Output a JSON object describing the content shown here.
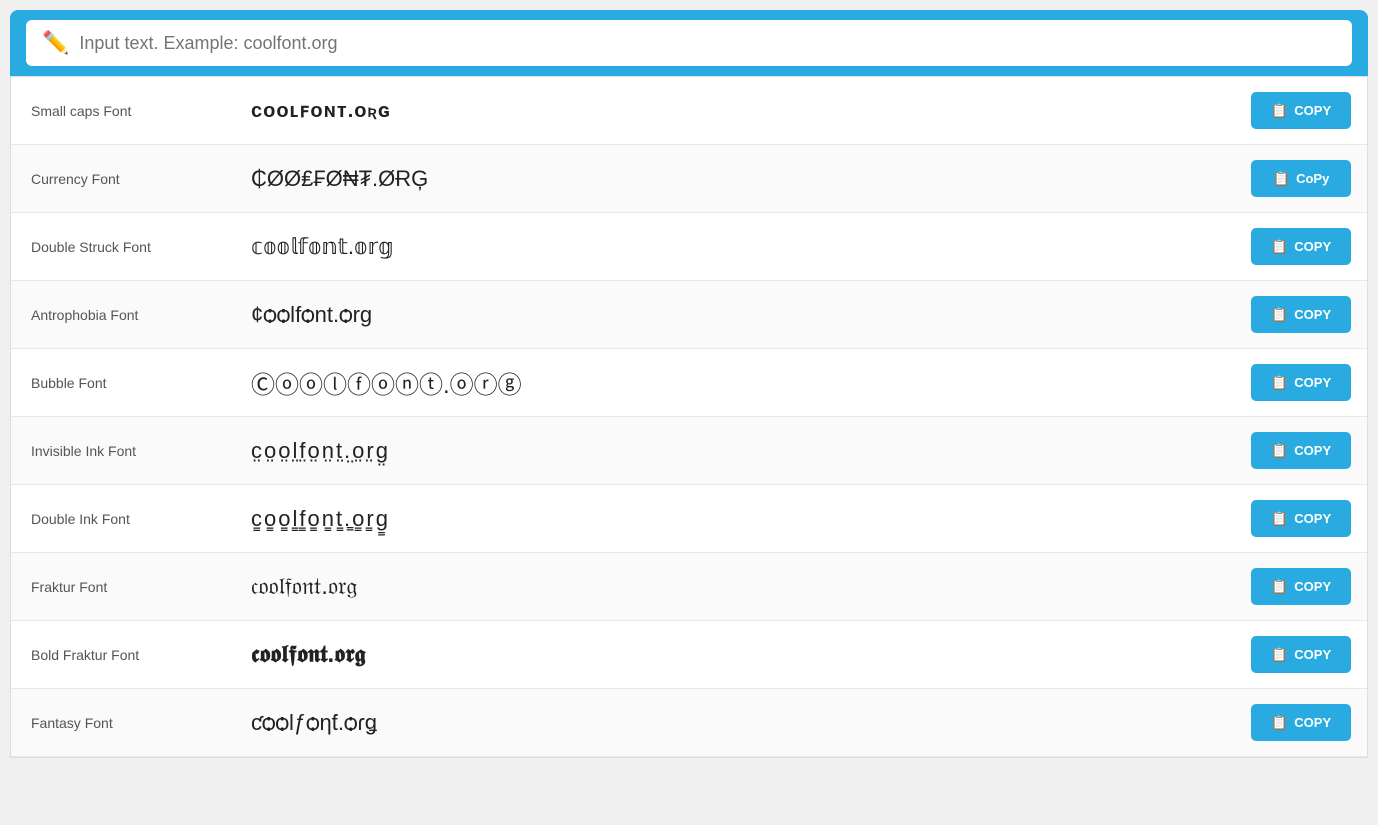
{
  "header": {
    "search_placeholder": "Input text. Example: coolfont.org",
    "pencil_icon": "✏️"
  },
  "rows": [
    {
      "label": "Small caps Font",
      "preview": "ᴄᴏᴏʟꜰᴏɴᴛ.ᴏʀɢ",
      "style": "small-caps-style",
      "copy_label": "COPY"
    },
    {
      "label": "Currency Font",
      "preview": "₵ØØ₤₣Ø₦₮.ØɌĢ",
      "style": "currency-style",
      "copy_label": "CoPy"
    },
    {
      "label": "Double Struck Font",
      "preview": "𝕔𝕠𝕠𝕝𝕗𝕠𝕟𝕥.𝕠𝕣𝕘",
      "style": "double-struck-style",
      "copy_label": "COPY"
    },
    {
      "label": "Antrophobia Font",
      "preview": "¢ѻѻlfѻnt.ѻrg",
      "style": "antrophobia-style",
      "copy_label": "COPY"
    },
    {
      "label": "Bubble Font",
      "preview": "Ⓒⓞⓞⓛⓕⓞⓝⓣ.ⓞⓡⓖ",
      "style": "bubble-style",
      "copy_label": "COPY"
    },
    {
      "label": "Invisible Ink Font",
      "preview": "c̤o̤o̤l̤f̤o̤n̤t̤.̤o̤r̤g̤",
      "style": "invisible-ink-style",
      "copy_label": "COPY"
    },
    {
      "label": "Double Ink Font",
      "preview": "c̳o̳o̳l̳f̳o̳n̳t̳.̳o̳r̳g̳",
      "style": "double-ink-style",
      "copy_label": "COPY"
    },
    {
      "label": "Fraktur Font",
      "preview": "𝔠𝔬𝔬𝔩𝔣𝔬𝔫𝔱.𝔬𝔯𝔤",
      "style": "fraktur-style",
      "copy_label": "COPY"
    },
    {
      "label": "Bold Fraktur Font",
      "preview": "𝖈𝖔𝖔𝖑𝖋𝖔𝖓𝖙.𝖔𝖗𝖌",
      "style": "bold-fraktur-style",
      "copy_label": "COPY"
    },
    {
      "label": "Fantasy Font",
      "preview": "ƈѻѻƖƒѻƞƭ.ѻɾǥ",
      "style": "fantasy-style",
      "copy_label": "COPY"
    }
  ],
  "colors": {
    "accent": "#29abe2",
    "button_bg": "#29abe2",
    "button_text": "#ffffff"
  }
}
